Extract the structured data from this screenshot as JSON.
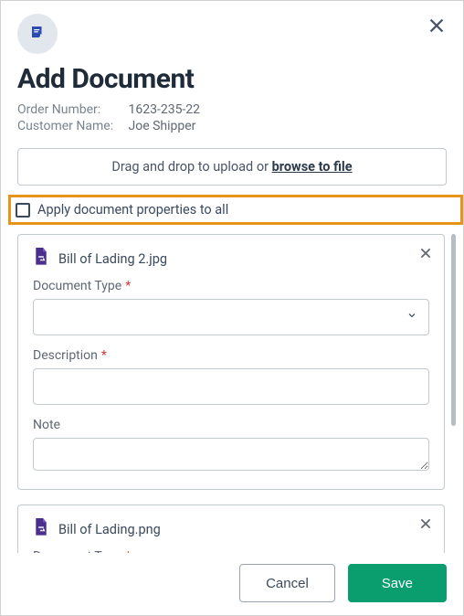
{
  "header": {
    "title": "Add Document",
    "order_number_label": "Order Number:",
    "order_number_value": "1623-235-22",
    "customer_name_label": "Customer Name:",
    "customer_name_value": "Joe Shipper"
  },
  "dropzone": {
    "text": "Drag and drop to upload or ",
    "link": "browse to file"
  },
  "apply_all": {
    "label": "Apply document properties to all",
    "checked": false
  },
  "labels": {
    "document_type": "Document Type",
    "description": "Description",
    "note": "Note",
    "required_marker": "*"
  },
  "documents": [
    {
      "filename": "Bill of Lading 2.jpg",
      "document_type": "",
      "description": "",
      "note": ""
    },
    {
      "filename": "Bill of Lading.png",
      "document_type": "",
      "description": "",
      "note": ""
    }
  ],
  "footer": {
    "cancel": "Cancel",
    "save": "Save"
  },
  "colors": {
    "highlight_border": "#e8941a",
    "primary_save": "#0a9d6e",
    "icon_purple": "#4a2f8f"
  }
}
